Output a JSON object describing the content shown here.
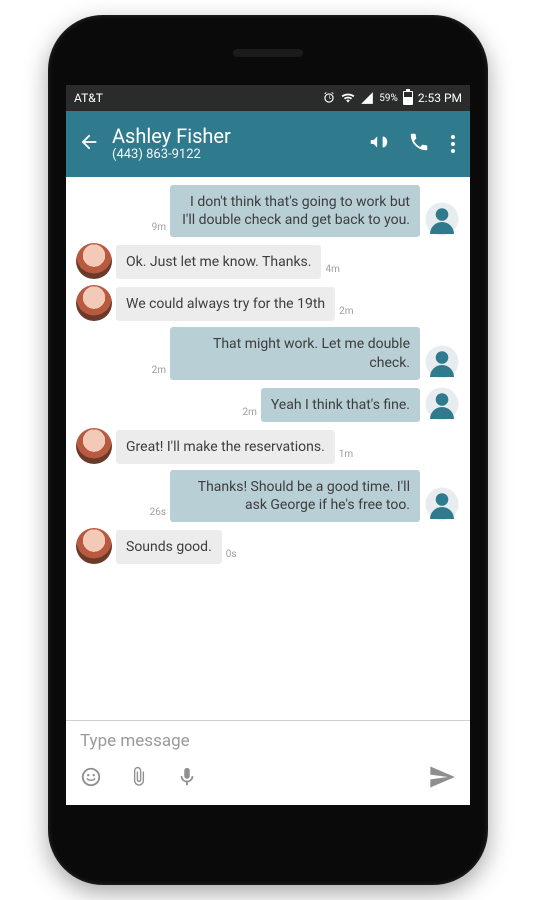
{
  "statusbar": {
    "carrier": "AT&T",
    "battery_pct": "59%",
    "time": "2:53 PM"
  },
  "header": {
    "contact_name": "Ashley Fisher",
    "contact_phone": "(443) 863-9122"
  },
  "messages": [
    {
      "dir": "out",
      "text": "I don't think that's going to work but I'll double check and get back to you.",
      "ts": "9m"
    },
    {
      "dir": "in",
      "text": "Ok.  Just let me know.  Thanks.",
      "ts": "4m"
    },
    {
      "dir": "in",
      "text": "We could always try for the 19th",
      "ts": "2m"
    },
    {
      "dir": "out",
      "text": "That might work. Let me double check.",
      "ts": "2m"
    },
    {
      "dir": "out",
      "text": "Yeah I think that's fine.",
      "ts": "2m"
    },
    {
      "dir": "in",
      "text": "Great!  I'll make the reservations.",
      "ts": "1m"
    },
    {
      "dir": "out",
      "text": "Thanks! Should be a good time. I'll ask George if he's free too.",
      "ts": "26s"
    },
    {
      "dir": "in",
      "text": "Sounds good.",
      "ts": "0s"
    }
  ],
  "compose": {
    "placeholder": "Type message"
  }
}
